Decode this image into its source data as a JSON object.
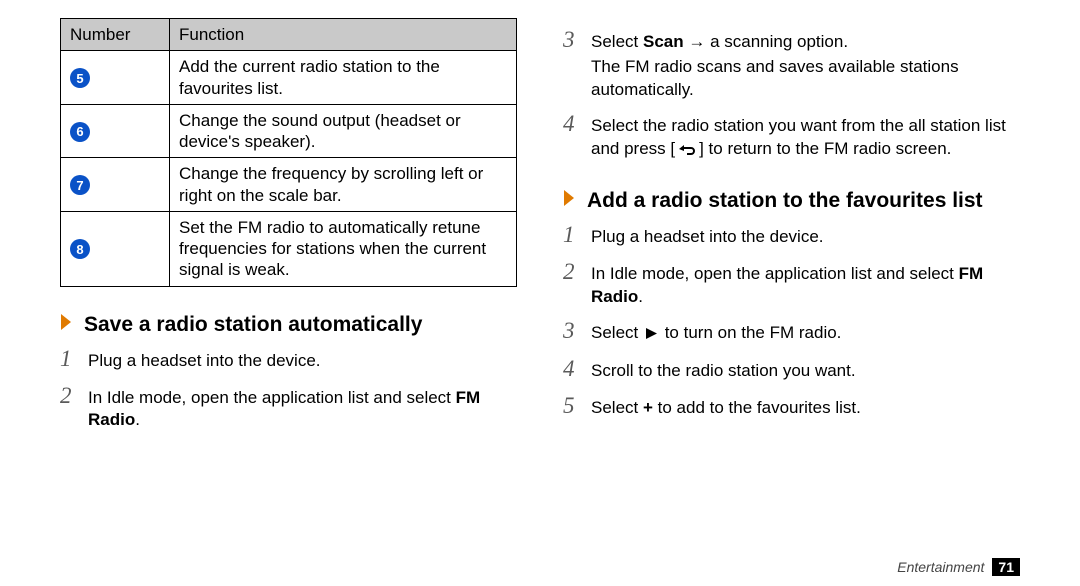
{
  "table": {
    "head_number": "Number",
    "head_function": "Function",
    "rows": [
      {
        "num": "5",
        "fn": "Add the current radio station to the favourites list."
      },
      {
        "num": "6",
        "fn": "Change the sound output (headset or device's speaker)."
      },
      {
        "num": "7",
        "fn": "Change the frequency by scrolling left or right on the scale bar."
      },
      {
        "num": "8",
        "fn": "Set the FM radio to automatically retune frequencies for stations when the current signal is weak."
      }
    ]
  },
  "section_save": {
    "title": "Save a radio station automatically",
    "steps": [
      {
        "n": "1",
        "text_before": "Plug a headset into the device."
      },
      {
        "n": "2",
        "text_before": "In Idle mode, open the application list and select ",
        "bold1": "FM Radio",
        "text_after": "."
      }
    ]
  },
  "section_save_cont": {
    "steps": [
      {
        "n": "3",
        "line1_before": "Select ",
        "line1_bold": "Scan",
        "line1_after": " → a scanning option.",
        "line2": "The FM radio scans and saves available stations automatically."
      },
      {
        "n": "4",
        "line1_before": "Select the radio station you want from the all station list and press [",
        "line1_after": "] to return to the FM radio screen."
      }
    ]
  },
  "section_fav": {
    "title": "Add a radio station to the favourites list",
    "steps": [
      {
        "n": "1",
        "text": "Plug a headset into the device."
      },
      {
        "n": "2",
        "before": "In Idle mode, open the application list and select ",
        "bold": "FM Radio",
        "after": "."
      },
      {
        "n": "3",
        "before": "Select ",
        "after": " to turn on the FM radio."
      },
      {
        "n": "4",
        "text": "Scroll to the radio station you want."
      },
      {
        "n": "5",
        "before": "Select ",
        "bold": "+",
        "after": " to add to the favourites list."
      }
    ]
  },
  "footer": {
    "section": "Entertainment",
    "page": "71"
  }
}
